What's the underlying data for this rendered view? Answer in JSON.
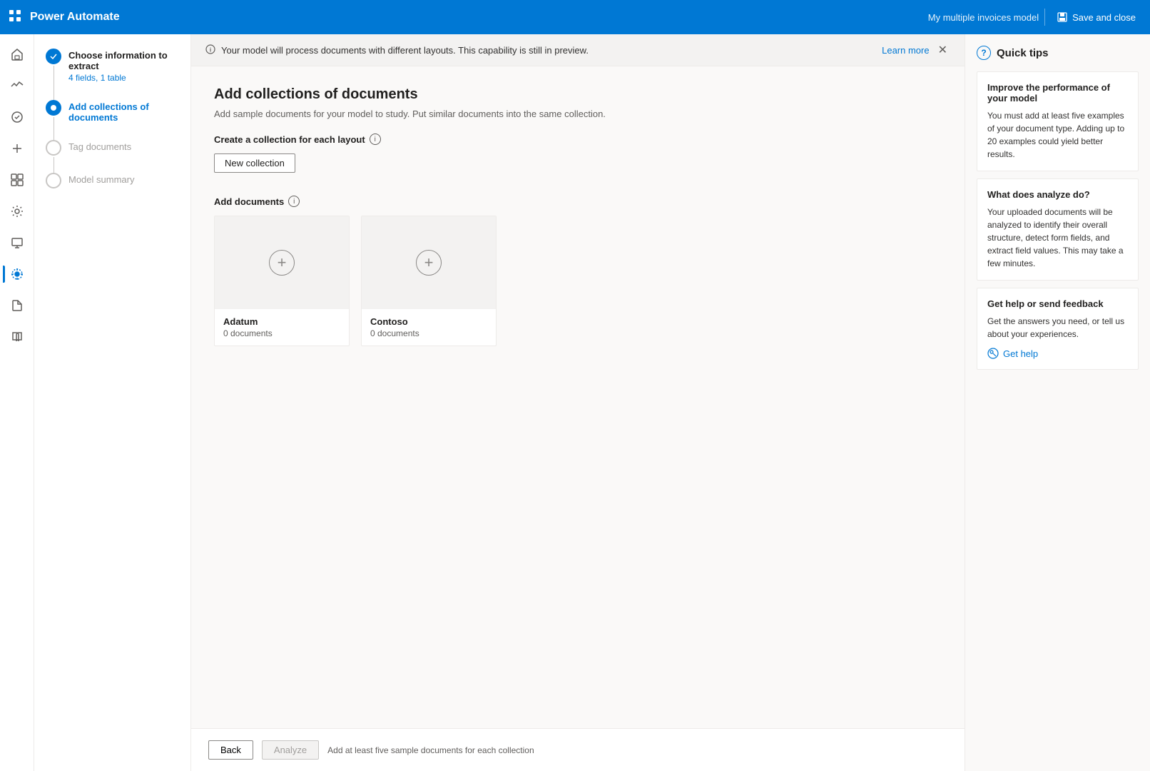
{
  "topbar": {
    "app_title": "Power Automate",
    "model_name": "My multiple invoices model",
    "save_close_label": "Save and close"
  },
  "steps": [
    {
      "id": "choose-info",
      "label": "Choose information to extract",
      "sublabel": "4 fields, 1 table",
      "state": "completed"
    },
    {
      "id": "add-collections",
      "label": "Add collections of documents",
      "sublabel": "",
      "state": "active"
    },
    {
      "id": "tag-documents",
      "label": "Tag documents",
      "sublabel": "",
      "state": "inactive"
    },
    {
      "id": "model-summary",
      "label": "Model summary",
      "sublabel": "",
      "state": "inactive"
    }
  ],
  "banner": {
    "text": "Your model will process documents with different layouts. This capability is still in preview.",
    "link_text": "Learn more",
    "link_url": "#"
  },
  "page": {
    "title": "Add collections of documents",
    "subtitle": "Add sample documents for your model to study. Put similar documents into the same collection.",
    "create_section_title": "Create a collection for each layout",
    "new_collection_label": "New collection",
    "add_documents_title": "Add documents"
  },
  "collections": [
    {
      "name": "Adatum",
      "doc_count": "0 documents"
    },
    {
      "name": "Contoso",
      "doc_count": "0 documents"
    }
  ],
  "footer": {
    "back_label": "Back",
    "analyze_label": "Analyze",
    "hint": "Add at least five sample documents for each collection"
  },
  "quick_tips": {
    "title": "Quick tips",
    "tips": [
      {
        "title": "Improve the performance of your model",
        "text": "You must add at least five examples of your document type. Adding up to 20 examples could yield better results."
      },
      {
        "title": "What does analyze do?",
        "text": "Your uploaded documents will be analyzed to identify their overall structure, detect form fields, and extract field values. This may take a few minutes."
      },
      {
        "title": "Get help or send feedback",
        "text": "Get the answers you need, or tell us about your experiences.",
        "has_link": true,
        "link_text": "Get help"
      }
    ]
  },
  "icons": {
    "grid": "⊞",
    "check": "✓",
    "info": "i",
    "question": "?",
    "close": "✕",
    "plus": "+"
  }
}
